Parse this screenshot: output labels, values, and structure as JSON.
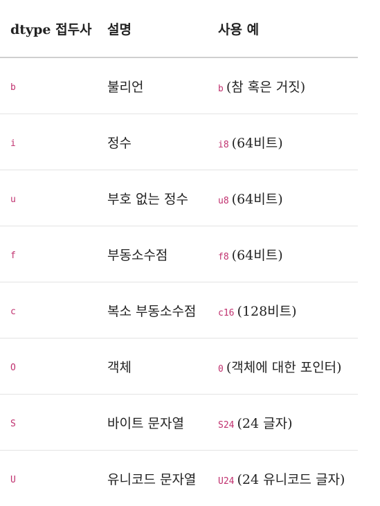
{
  "header": {
    "col1": "dtype 접두사",
    "col2": "설명",
    "col3": "사용 예"
  },
  "rows": [
    {
      "prefix": "b",
      "description": "불리언",
      "example_code": "b",
      "example_text": "(참 혹은 거짓)"
    },
    {
      "prefix": "i",
      "description": "정수",
      "example_code": "i8",
      "example_text": "(64비트)"
    },
    {
      "prefix": "u",
      "description": "부호 없는 정수",
      "example_code": "u8",
      "example_text": "(64비트)"
    },
    {
      "prefix": "f",
      "description": "부동소수점",
      "example_code": "f8",
      "example_text": "(64비트)"
    },
    {
      "prefix": "c",
      "description": "복소 부동소수점",
      "example_code": "c16",
      "example_text": "(128비트)"
    },
    {
      "prefix": "O",
      "description": "객체",
      "example_code": "0",
      "example_text": "(객체에 대한 포인터)"
    },
    {
      "prefix": "S",
      "description": "바이트 문자열",
      "example_code": "S24",
      "example_text": "(24 글자)"
    },
    {
      "prefix": "U",
      "description": "유니코드 문자열",
      "example_code": "U24",
      "example_text": "(24 유니코드 글자)"
    }
  ],
  "colors": {
    "code": "#c0306e",
    "text": "#222222",
    "header_rule": "#cfcfcf",
    "row_rule": "#e3e3e3"
  }
}
